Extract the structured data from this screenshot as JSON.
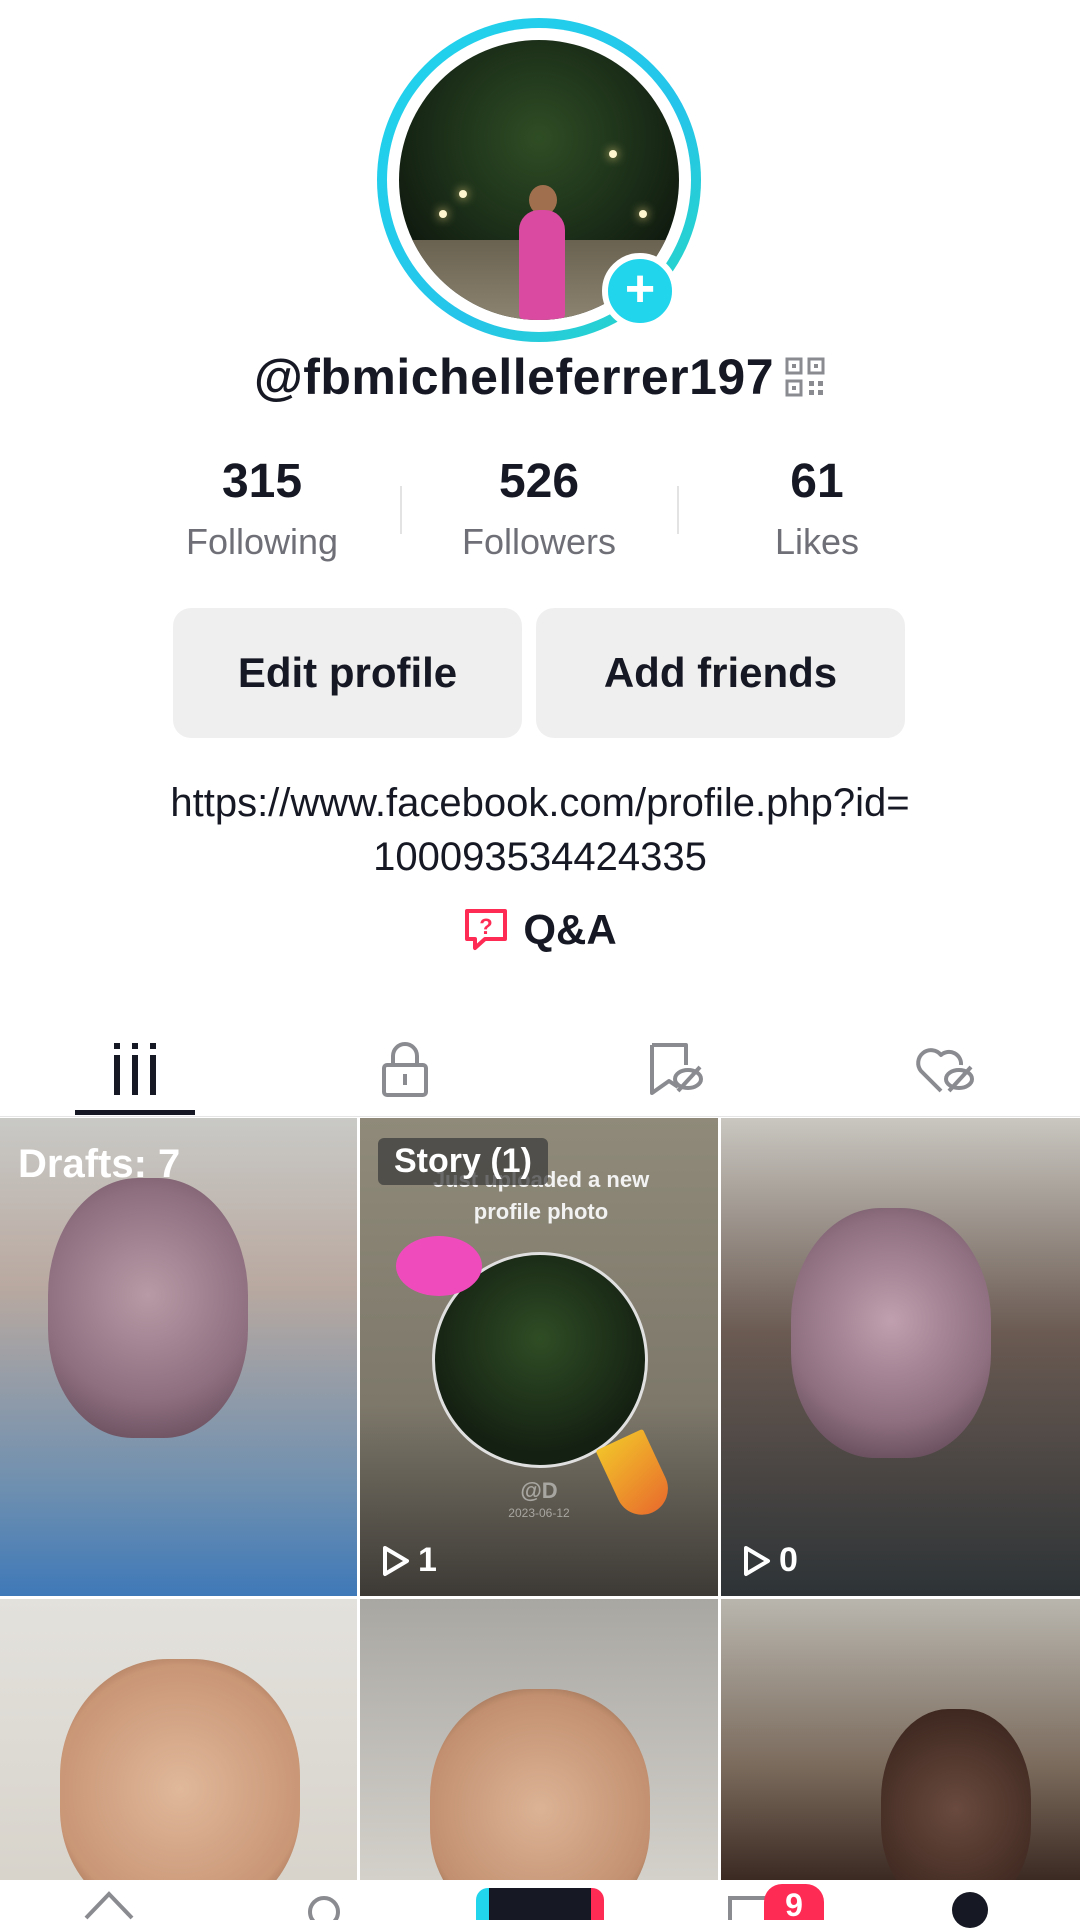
{
  "profile": {
    "username": "@fbmichelleferrer197",
    "add_symbol": "+"
  },
  "stats": [
    {
      "value": "315",
      "label": "Following"
    },
    {
      "value": "526",
      "label": "Followers"
    },
    {
      "value": "61",
      "label": "Likes"
    }
  ],
  "buttons": {
    "edit_profile": "Edit profile",
    "add_friends": "Add friends"
  },
  "bio": {
    "line1": "https://www.facebook.com/profile.php?id=",
    "line2": "100093534424335"
  },
  "qa": {
    "label": "Q&A",
    "icon": "question-answer-icon"
  },
  "tabs": [
    {
      "icon": "videos-grid-icon",
      "active": true
    },
    {
      "icon": "lock-icon",
      "active": false
    },
    {
      "icon": "favorites-hidden-icon",
      "active": false
    },
    {
      "icon": "liked-hidden-icon",
      "active": false
    }
  ],
  "grid": {
    "drafts_label": "Drafts: 7",
    "story_label": "Story (1)",
    "story_caption": "Just uploaded a new profile photo",
    "story_handle": "@D",
    "story_date": "2023-06-12",
    "views_story": "1",
    "views_third": "0"
  },
  "bottom_nav": {
    "inbox_badge": "9"
  },
  "colors": {
    "accent": "#20d5ec",
    "badge": "#fe2c55",
    "text": "#161823",
    "muted": "#6f7077"
  }
}
